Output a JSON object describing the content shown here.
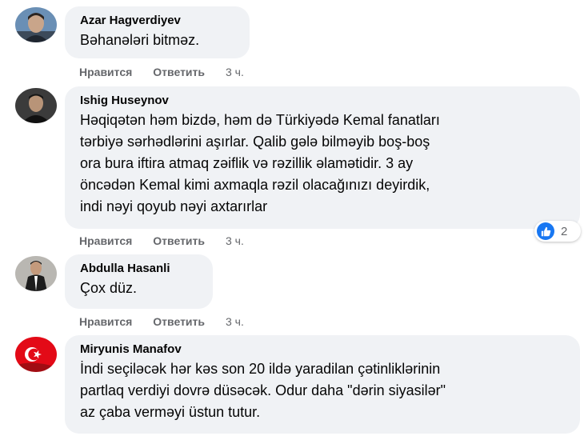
{
  "comments": [
    {
      "author": "Azar Hagverdiyev",
      "lines": [
        "Bəhanələri bitməz."
      ],
      "like_label": "Нравится",
      "reply_label": "Ответить",
      "time": "3 ч."
    },
    {
      "author": "Ishig Huseynov",
      "lines": [
        "Həqiqətən həm bizdə, həm də Türkiyədə Kemal fanatları",
        "tərbiyə sərhədlərini aşırlar. Qalib gələ bilməyib boş-boş",
        "ora bura iftira atmaq zəiflik və rəzillik əlamətidir. 3 ay",
        "öncədən Kemal kimi axmaqla rəzil olacağınızı deyirdik,",
        "indi nəyi qoyub nəyi axtarırlar"
      ],
      "like_label": "Нравится",
      "reply_label": "Ответить",
      "time": "3 ч.",
      "reactions": {
        "icon": "thumbs-up-icon",
        "count": "2",
        "color": "#1877f2"
      }
    },
    {
      "author": "Abdulla Hasanli",
      "lines": [
        "Çox düz."
      ],
      "like_label": "Нравится",
      "reply_label": "Ответить",
      "time": "3 ч."
    },
    {
      "author": "Miryunis Manafov",
      "lines": [
        "İndi seçiləcək hər kəs son 20 ildə yaradilan çətinliklərinin",
        "partlaq verdiyi dovrə düsəcək. Odur daha \"dərin siyasilər\"",
        "az çaba verməyi üstun tutur."
      ]
    }
  ]
}
